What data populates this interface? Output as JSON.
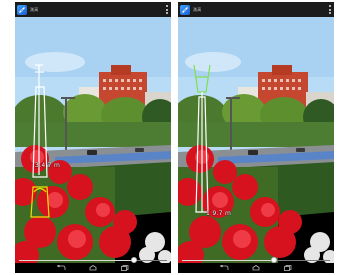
{
  "screens": [
    {
      "app_title": "測高",
      "measurement_text": "3.4 7 m",
      "slider_value_fraction": 0.78
    },
    {
      "app_title": "測高",
      "measurement_text": "1 9.7 m",
      "slider_value_fraction": 0.62
    }
  ],
  "colors": {
    "sky": "#b8dcf5",
    "flowers": "#d6121f",
    "guide_white": "#ffffff",
    "guide_yellow": "#f0e200",
    "guide_green": "#7fe04d",
    "app_icon": "#2a7fe8"
  },
  "icons": {
    "app": "ruler-icon",
    "menu": "overflow-menu-icon",
    "back": "back-icon",
    "home": "home-icon",
    "recents": "recents-icon"
  }
}
